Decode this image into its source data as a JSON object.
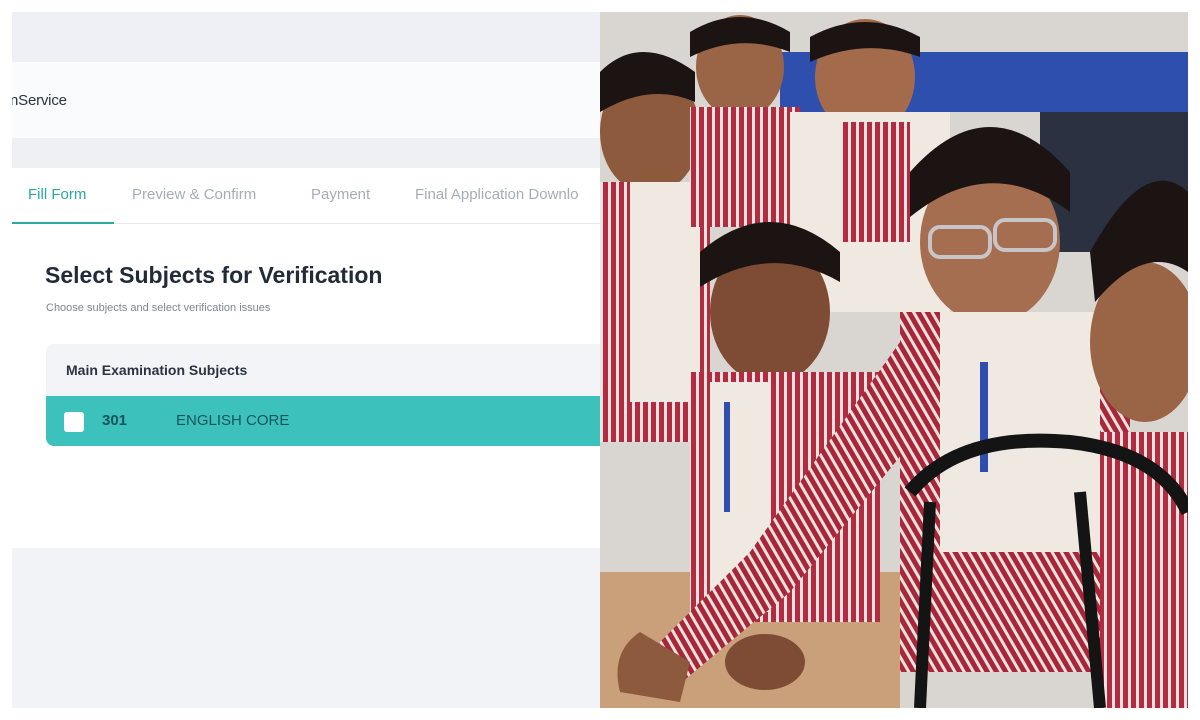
{
  "app": {
    "title": "nService"
  },
  "tabs": [
    {
      "label": "Fill Form",
      "active": true
    },
    {
      "label": "Preview & Confirm",
      "active": false
    },
    {
      "label": "Payment",
      "active": false
    },
    {
      "label": "Final Application Downlo",
      "active": false
    }
  ],
  "section": {
    "title": "Select Subjects for Verification",
    "subtitle": "Choose subjects and select verification issues"
  },
  "subjects_table": {
    "header": "Main Examination Subjects",
    "rows": [
      {
        "code": "301",
        "name": "ENGLISH CORE",
        "checked": false
      }
    ]
  },
  "colors": {
    "accent": "#2aa8a4",
    "row_highlight": "#3cc1bd",
    "uniform_stripe": "#a8263a"
  }
}
